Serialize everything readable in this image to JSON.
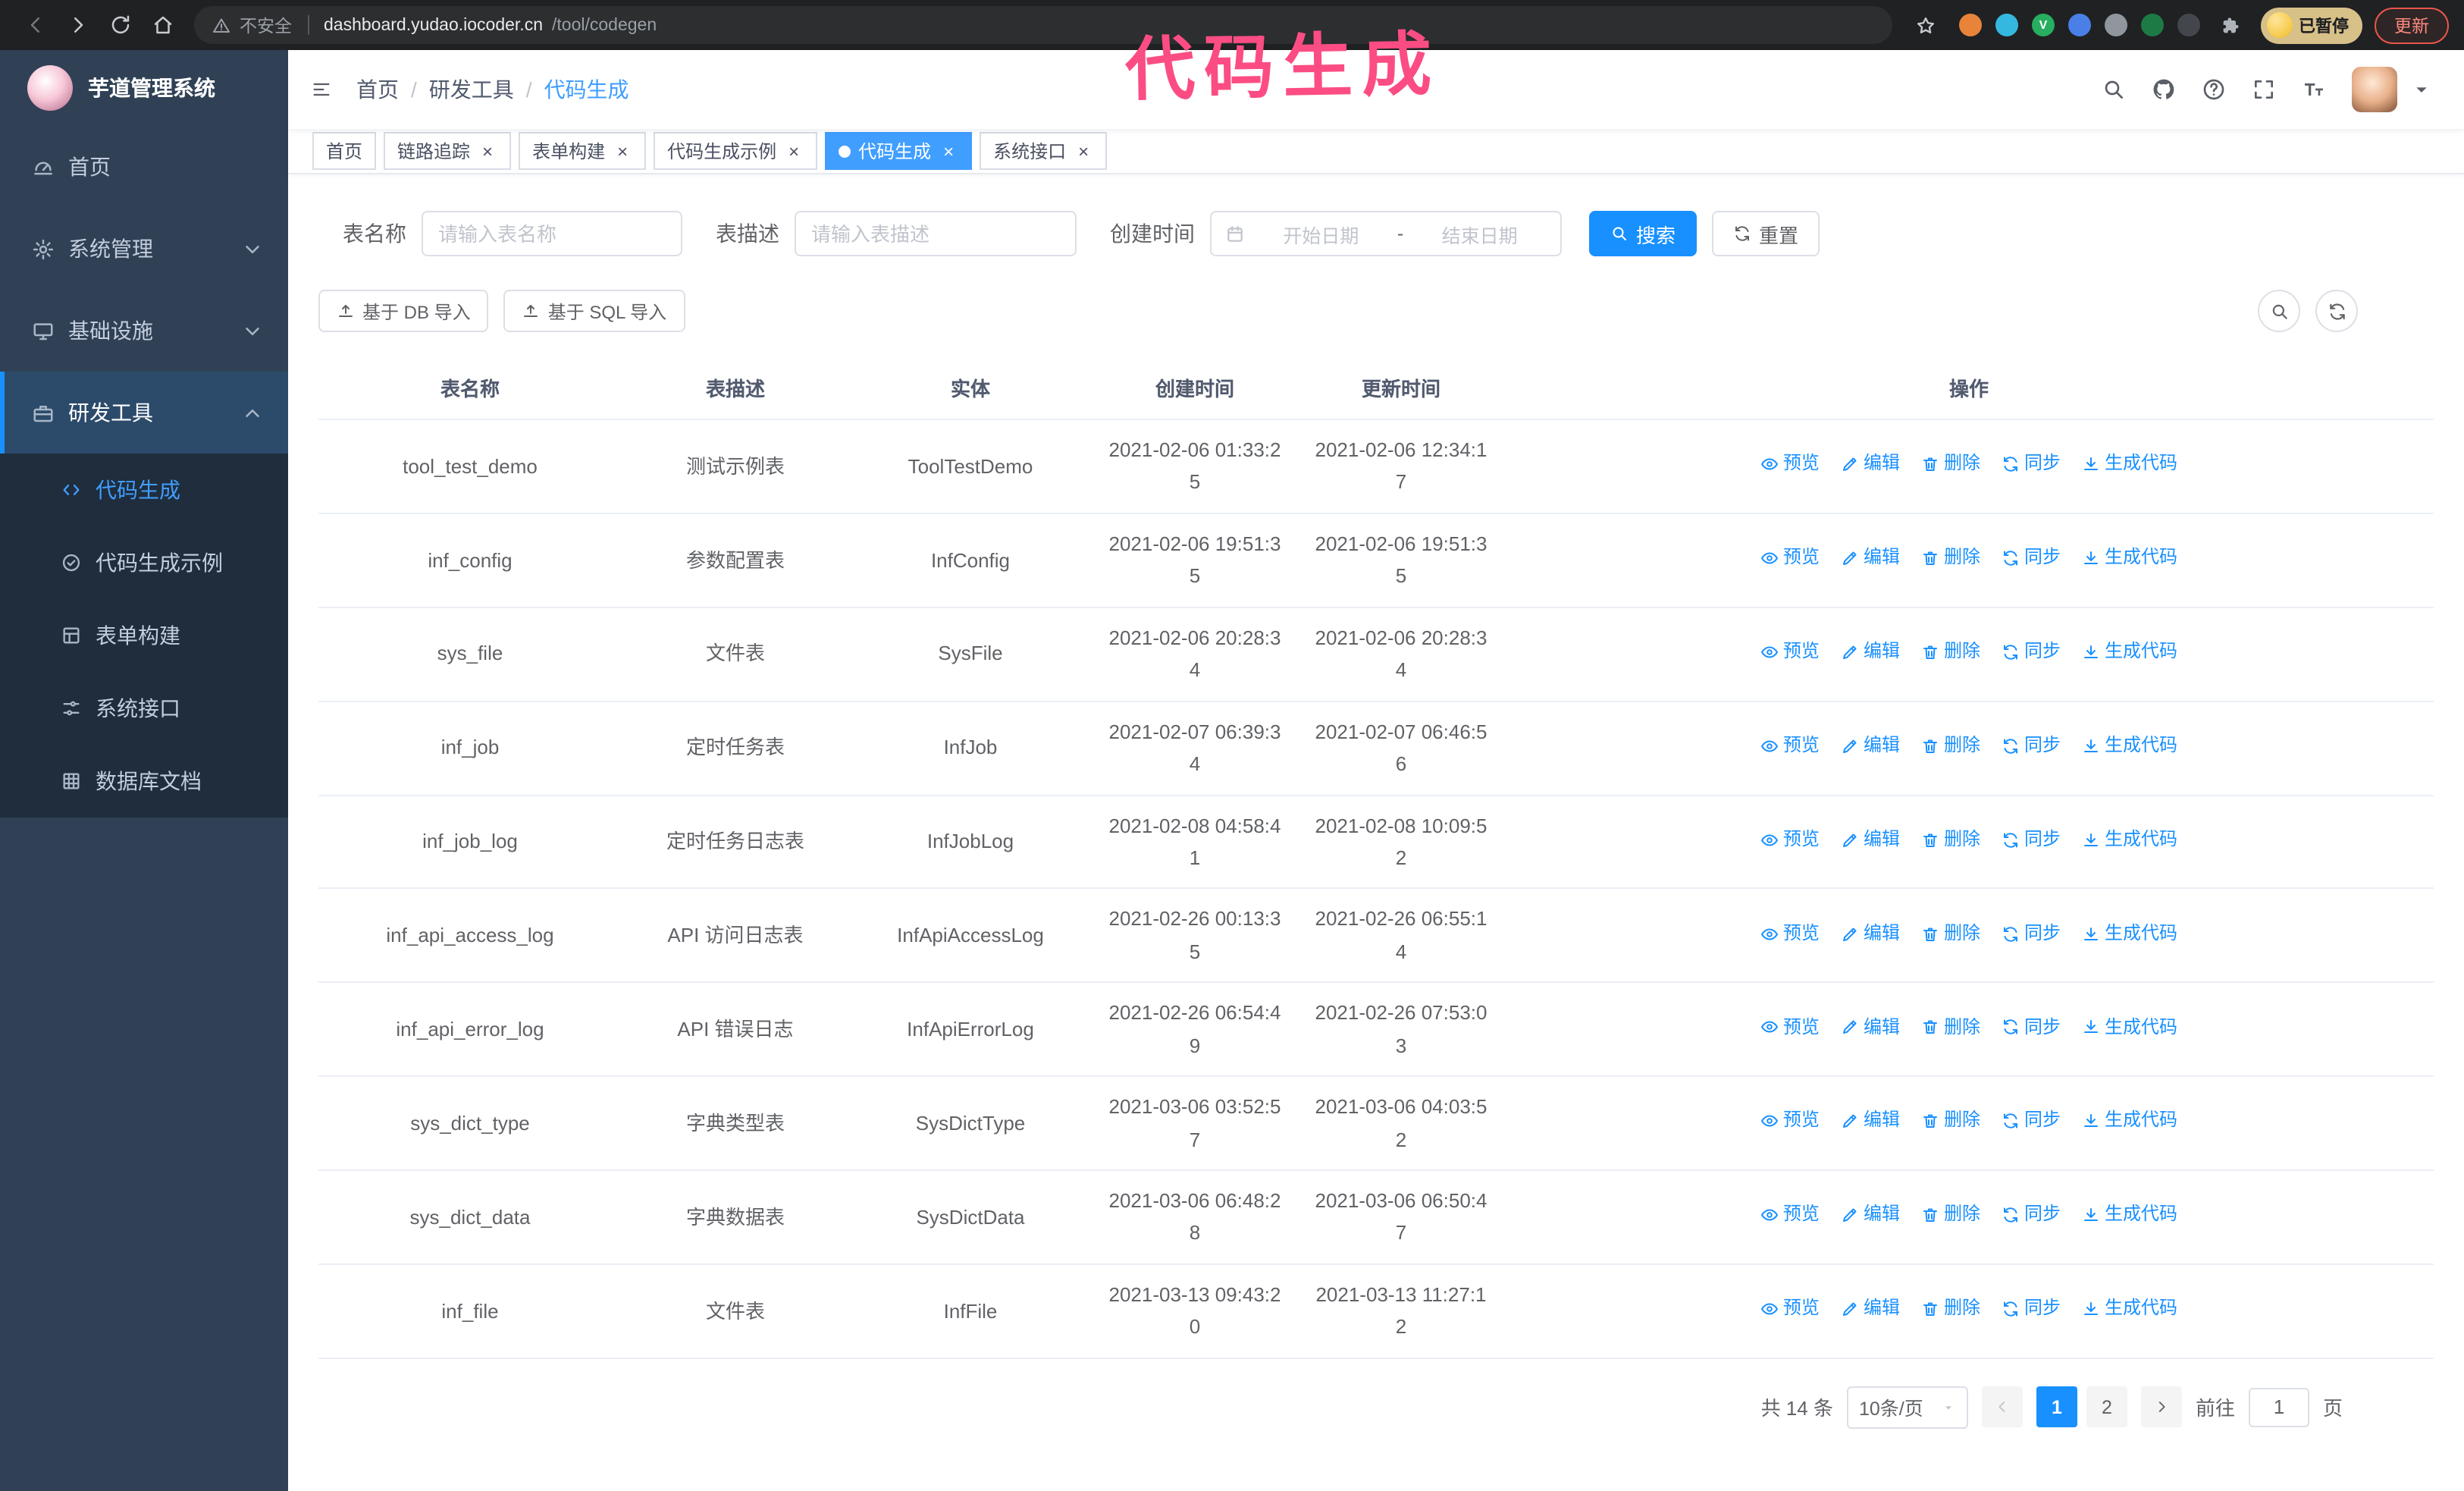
{
  "colors": {
    "accent": "#1890ff",
    "tab_active": "#409eff",
    "sidebar_bg": "#304156",
    "submenu_bg": "#1f2d3d",
    "annotation": "#fb4d83",
    "danger": "#e8564a"
  },
  "annotation": "代码生成",
  "browser": {
    "security_label": "不安全",
    "url_host": "dashboard.yudao.iocoder.cn",
    "url_path": "/tool/codegen",
    "profile_badge": "已暂停",
    "update_button": "更新",
    "extensions": [
      {
        "name": "extension-icon-1",
        "color": "#e8833a"
      },
      {
        "name": "extension-icon-2",
        "color": "#35b8e0"
      },
      {
        "name": "extension-icon-3",
        "color": "#27ae60",
        "glyph": "V"
      },
      {
        "name": "extension-icon-4",
        "color": "#4a7fe8"
      },
      {
        "name": "extension-icon-5",
        "color": "#8f969e"
      },
      {
        "name": "extension-icon-6",
        "color": "#1d7a45"
      },
      {
        "name": "extension-icon-7",
        "color": "#43474d"
      }
    ]
  },
  "sidebar": {
    "logo_title": "芋道管理系统",
    "items": [
      {
        "key": "home",
        "label": "首页",
        "icon": "dashboard"
      },
      {
        "key": "system",
        "label": "系统管理",
        "icon": "gear",
        "caret": "down"
      },
      {
        "key": "infra",
        "label": "基础设施",
        "icon": "monitor",
        "caret": "down"
      },
      {
        "key": "dev-tools",
        "label": "研发工具",
        "icon": "toolbox",
        "caret": "up",
        "active": true
      }
    ],
    "subitems": [
      {
        "key": "codegen",
        "label": "代码生成",
        "icon": "code",
        "active": true
      },
      {
        "key": "codegen-example",
        "label": "代码生成示例",
        "icon": "badge"
      },
      {
        "key": "form-build",
        "label": "表单构建",
        "icon": "form"
      },
      {
        "key": "system-api",
        "label": "系统接口",
        "icon": "sliders"
      },
      {
        "key": "db-doc",
        "label": "数据库文档",
        "icon": "grid"
      }
    ]
  },
  "breadcrumb": [
    "首页",
    "研发工具",
    "代码生成"
  ],
  "tabs": [
    {
      "key": "home",
      "label": "首页",
      "closable": false
    },
    {
      "key": "tracer",
      "label": "链路追踪",
      "closable": true
    },
    {
      "key": "form-build",
      "label": "表单构建",
      "closable": true
    },
    {
      "key": "codegen-example",
      "label": "代码生成示例",
      "closable": true
    },
    {
      "key": "codegen",
      "label": "代码生成",
      "closable": true,
      "active": true
    },
    {
      "key": "system-api",
      "label": "系统接口",
      "closable": true
    }
  ],
  "filters": {
    "table_name_label": "表名称",
    "table_name_placeholder": "请输入表名称",
    "table_desc_label": "表描述",
    "table_desc_placeholder": "请输入表描述",
    "create_time_label": "创建时间",
    "date_start_placeholder": "开始日期",
    "date_separator": "-",
    "date_end_placeholder": "结束日期",
    "search_button": "搜索",
    "reset_button": "重置"
  },
  "toolbar": {
    "import_db_button": "基于 DB 导入",
    "import_sql_button": "基于 SQL 导入"
  },
  "table": {
    "columns": [
      "表名称",
      "表描述",
      "实体",
      "创建时间",
      "更新时间",
      "操作"
    ],
    "actions": [
      {
        "key": "preview",
        "label": "预览",
        "icon": "eye"
      },
      {
        "key": "edit",
        "label": "编辑",
        "icon": "edit"
      },
      {
        "key": "delete",
        "label": "删除",
        "icon": "trash"
      },
      {
        "key": "sync",
        "label": "同步",
        "icon": "sync"
      },
      {
        "key": "generate",
        "label": "生成代码",
        "icon": "download"
      }
    ],
    "rows": [
      {
        "name": "tool_test_demo",
        "desc": "测试示例表",
        "entity": "ToolTestDemo",
        "created": "2021-02-06 01:33:25",
        "updated": "2021-02-06 12:34:17"
      },
      {
        "name": "inf_config",
        "desc": "参数配置表",
        "entity": "InfConfig",
        "created": "2021-02-06 19:51:35",
        "updated": "2021-02-06 19:51:35"
      },
      {
        "name": "sys_file",
        "desc": "文件表",
        "entity": "SysFile",
        "created": "2021-02-06 20:28:34",
        "updated": "2021-02-06 20:28:34"
      },
      {
        "name": "inf_job",
        "desc": "定时任务表",
        "entity": "InfJob",
        "created": "2021-02-07 06:39:34",
        "updated": "2021-02-07 06:46:56"
      },
      {
        "name": "inf_job_log",
        "desc": "定时任务日志表",
        "entity": "InfJobLog",
        "created": "2021-02-08 04:58:41",
        "updated": "2021-02-08 10:09:52"
      },
      {
        "name": "inf_api_access_log",
        "desc": "API 访问日志表",
        "entity": "InfApiAccessLog",
        "created": "2021-02-26 00:13:35",
        "updated": "2021-02-26 06:55:14"
      },
      {
        "name": "inf_api_error_log",
        "desc": "API 错误日志",
        "entity": "InfApiErrorLog",
        "created": "2021-02-26 06:54:49",
        "updated": "2021-02-26 07:53:03"
      },
      {
        "name": "sys_dict_type",
        "desc": "字典类型表",
        "entity": "SysDictType",
        "created": "2021-03-06 03:52:57",
        "updated": "2021-03-06 04:03:52"
      },
      {
        "name": "sys_dict_data",
        "desc": "字典数据表",
        "entity": "SysDictData",
        "created": "2021-03-06 06:48:28",
        "updated": "2021-03-06 06:50:47"
      },
      {
        "name": "inf_file",
        "desc": "文件表",
        "entity": "InfFile",
        "created": "2021-03-13 09:43:20",
        "updated": "2021-03-13 11:27:12"
      }
    ]
  },
  "pagination": {
    "total": "共 14 条",
    "page_size": "10条/页",
    "pages": [
      "1",
      "2"
    ],
    "active_page": "1",
    "goto_label": "前往",
    "goto_value": "1",
    "page_unit": "页"
  }
}
